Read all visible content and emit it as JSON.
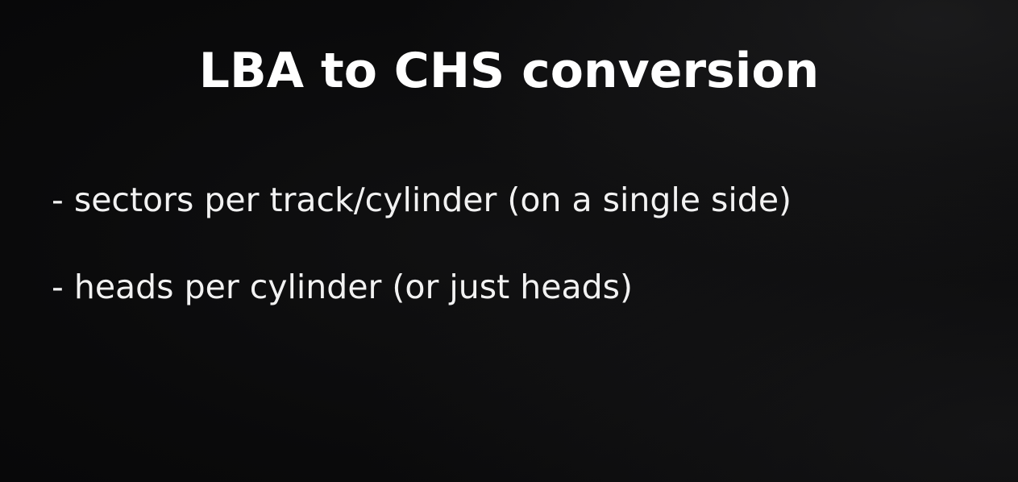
{
  "slide": {
    "title": "LBA to CHS conversion",
    "bullets": [
      {
        "text": "- sectors per track/cylinder (on a single side)"
      },
      {
        "text": "- heads per cylinder (or just heads)"
      }
    ]
  }
}
